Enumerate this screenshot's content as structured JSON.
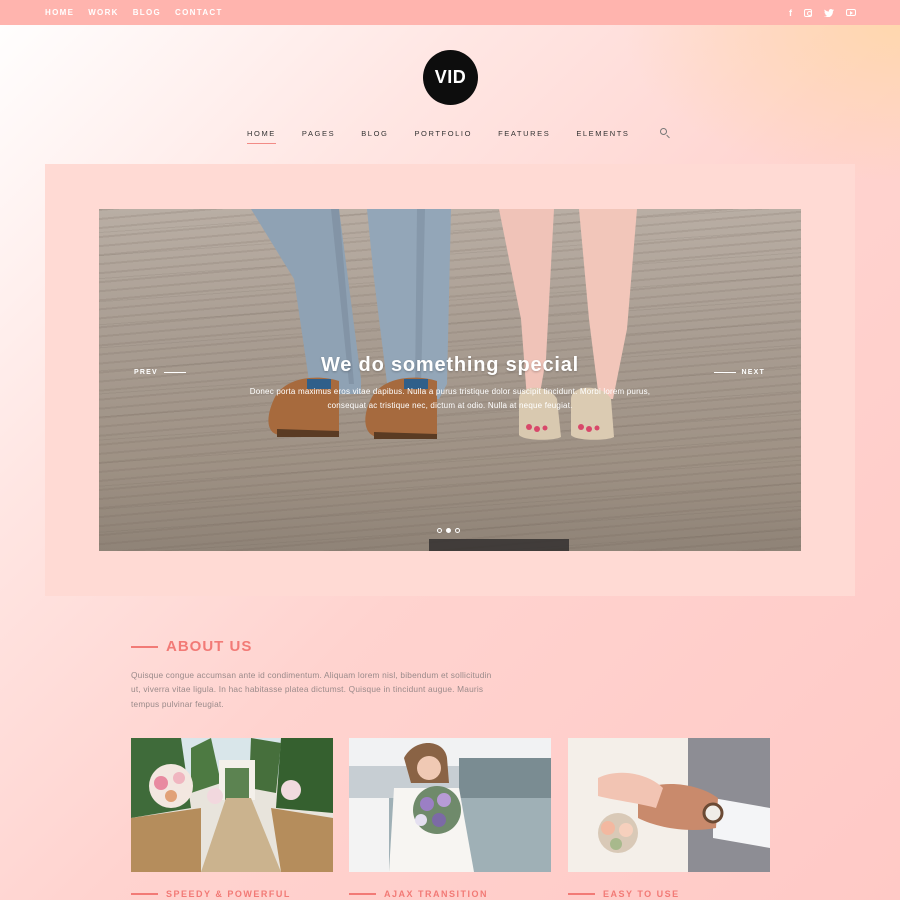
{
  "topbar": {
    "nav": [
      "HOME",
      "WORK",
      "BLOG",
      "CONTACT"
    ],
    "social_icons": [
      "facebook-icon",
      "instagram-icon",
      "twitter-icon",
      "youtube-icon"
    ]
  },
  "logo": {
    "text": "VID"
  },
  "nav": {
    "items": [
      "HOME",
      "PAGES",
      "BLOG",
      "PORTFOLIO",
      "FEATURES",
      "ELEMENTS"
    ],
    "active_index": 0,
    "search_icon": "search-icon"
  },
  "slider": {
    "title": "We do something special",
    "text": "Donec porta maximus eros vitae dapibus. Nulla a purus tristique dolor suscipit tincidunt. Morbi lorem purus, consequat ac tristique nec, dictum at odio. Nulla at neque feugiat.",
    "prev_label": "PREV",
    "next_label": "NEXT",
    "slide_count": 3,
    "active_slide": 1
  },
  "about": {
    "title": "ABOUT US",
    "text": "Quisque congue accumsan ante id condimentum. Aliquam lorem nisl, bibendum et sollicitudin ut, viverra vitae ligula. In hac habitasse platea dictumst. Quisque in tincidunt augue. Mauris tempus pulvinar feugiat."
  },
  "features": [
    {
      "label": "SPEEDY & POWERFUL"
    },
    {
      "label": "AJAX TRANSITION"
    },
    {
      "label": "EASY TO USE"
    }
  ],
  "colors": {
    "accent": "#f27a76",
    "topbar": "#ffb4ae",
    "hero_frame": "#ffdad4",
    "logo": "#0d0d0d"
  }
}
